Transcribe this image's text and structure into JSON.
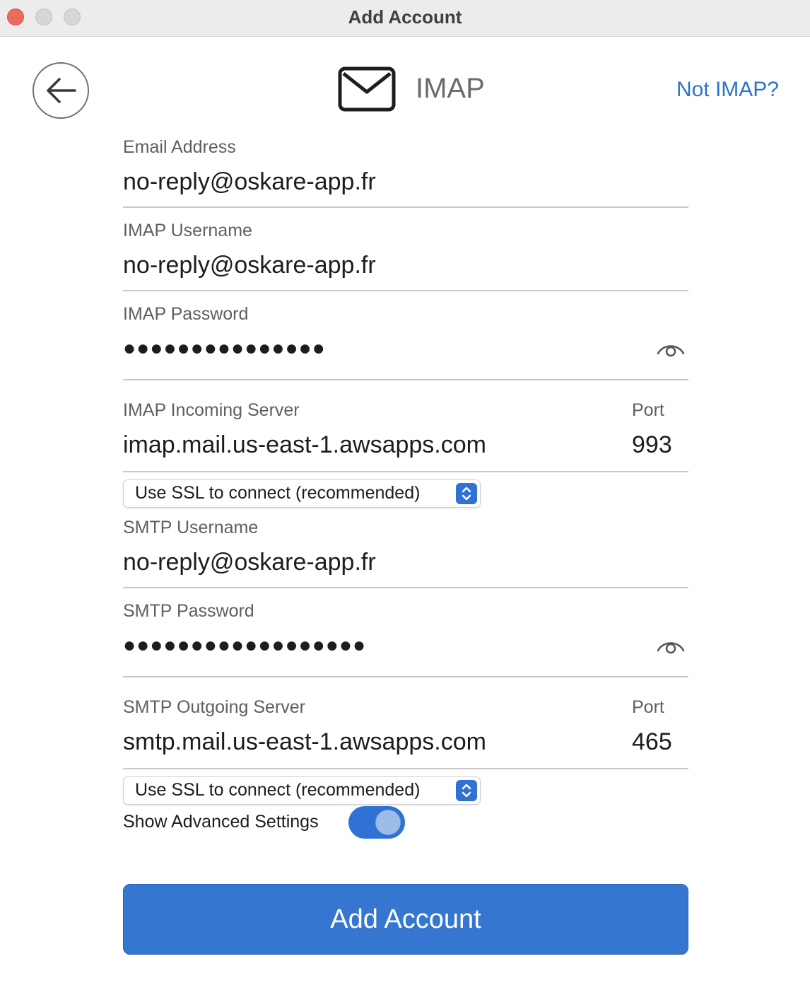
{
  "window": {
    "title": "Add Account"
  },
  "header": {
    "provider": "IMAP",
    "not_provider_link": "Not IMAP?"
  },
  "fields": {
    "email": {
      "label": "Email Address",
      "value": "no-reply@oskare-app.fr"
    },
    "imap_username": {
      "label": "IMAP Username",
      "value": "no-reply@oskare-app.fr"
    },
    "imap_password": {
      "label": "IMAP Password",
      "masked": "●●●●●●●●●●●●●●●"
    },
    "imap_server": {
      "label": "IMAP Incoming Server",
      "value": "imap.mail.us-east-1.awsapps.com",
      "port_label": "Port",
      "port": "993"
    },
    "imap_ssl": {
      "selected": "Use SSL to connect (recommended)"
    },
    "smtp_username": {
      "label": "SMTP Username",
      "value": "no-reply@oskare-app.fr"
    },
    "smtp_password": {
      "label": "SMTP Password",
      "masked": "●●●●●●●●●●●●●●●●●●"
    },
    "smtp_server": {
      "label": "SMTP Outgoing Server",
      "value": "smtp.mail.us-east-1.awsapps.com",
      "port_label": "Port",
      "port": "465"
    },
    "smtp_ssl": {
      "selected": "Use SSL to connect (recommended)"
    }
  },
  "advanced": {
    "label": "Show Advanced Settings",
    "enabled": true
  },
  "actions": {
    "add_account": "Add Account"
  },
  "colors": {
    "accent": "#2f72d3",
    "link": "#2d73c9",
    "close": "#ed6a5e"
  },
  "icons": [
    "back-arrow-icon",
    "mail-envelope-icon",
    "eye-icon",
    "up-down-chevron-icon"
  ]
}
